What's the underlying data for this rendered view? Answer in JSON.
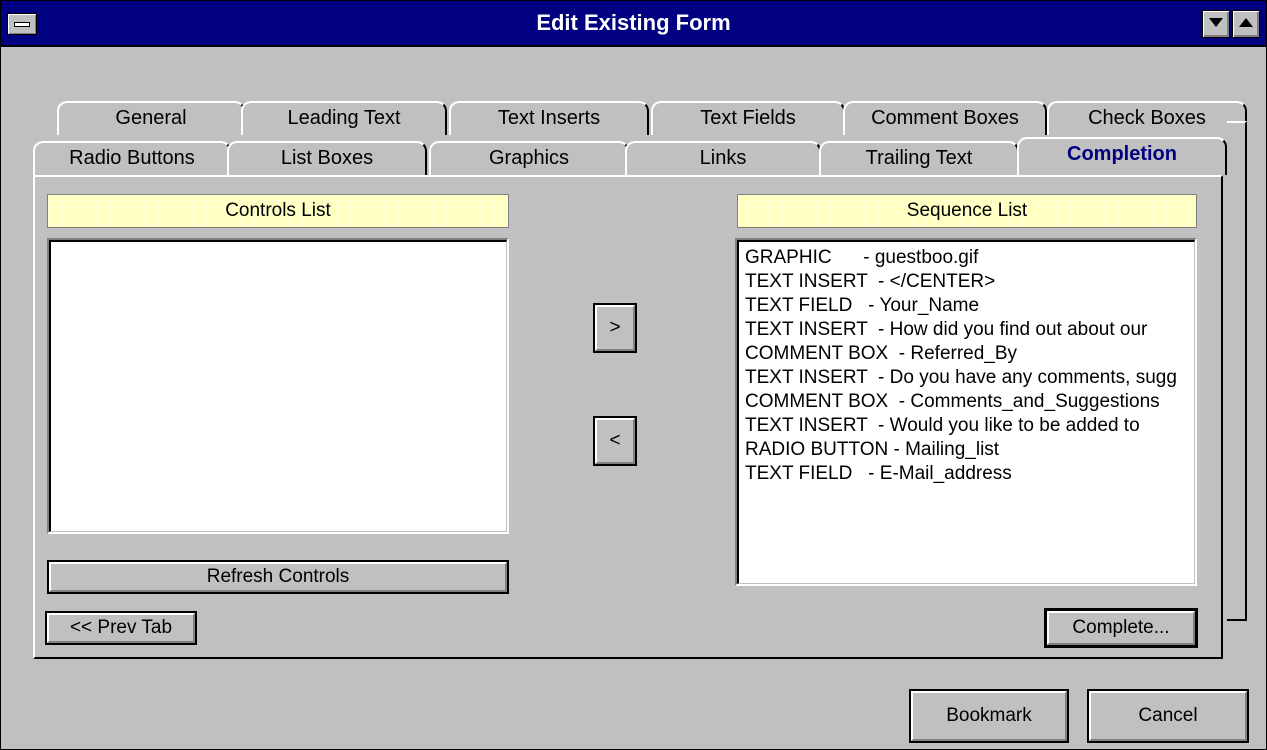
{
  "window": {
    "title": "Edit Existing Form"
  },
  "tabs_back": [
    {
      "label": "General"
    },
    {
      "label": "Leading Text"
    },
    {
      "label": "Text Inserts"
    },
    {
      "label": "Text Fields"
    },
    {
      "label": "Comment Boxes"
    },
    {
      "label": "Check Boxes"
    }
  ],
  "tabs_front": [
    {
      "label": "Radio Buttons"
    },
    {
      "label": "List Boxes"
    },
    {
      "label": "Graphics"
    },
    {
      "label": "Links"
    },
    {
      "label": "Trailing Text"
    },
    {
      "label": "Completion"
    }
  ],
  "controls": {
    "header": "Controls List",
    "items": []
  },
  "sequence": {
    "header": "Sequence List",
    "items": [
      "GRAPHIC      - guestboo.gif",
      "TEXT INSERT  - </CENTER>",
      "TEXT FIELD   - Your_Name",
      "TEXT INSERT  - How did you find out about our",
      "COMMENT BOX  - Referred_By",
      "TEXT INSERT  - Do you have any comments, sugg",
      "COMMENT BOX  - Comments_and_Suggestions",
      "TEXT INSERT  - Would you like to be added to",
      "RADIO BUTTON - Mailing_list",
      "TEXT FIELD   - E-Mail_address"
    ]
  },
  "buttons": {
    "add": ">",
    "remove": "<",
    "refresh": "Refresh Controls",
    "prev_tab": "<< Prev Tab",
    "complete": "Complete...",
    "bookmark": "Bookmark",
    "cancel": "Cancel"
  },
  "colors": {
    "titlebar": "#000080",
    "active_tab": "#000080",
    "header_bg": "#ffffd8",
    "face": "#c0c0c0"
  }
}
